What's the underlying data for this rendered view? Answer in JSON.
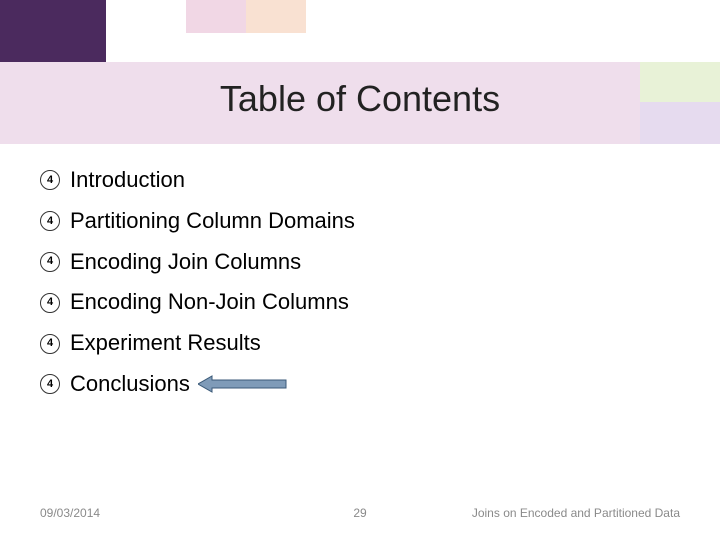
{
  "title": "Table of Contents",
  "bullet_number": "4",
  "items": [
    {
      "label": "Introduction",
      "highlighted": false
    },
    {
      "label": "Partitioning Column Domains",
      "highlighted": false
    },
    {
      "label": "Encoding Join Columns",
      "highlighted": false
    },
    {
      "label": "Encoding Non-Join Columns",
      "highlighted": false
    },
    {
      "label": "Experiment Results",
      "highlighted": false
    },
    {
      "label": "Conclusions",
      "highlighted": true
    }
  ],
  "footer": {
    "date": "09/03/2014",
    "page": "29",
    "title": "Joins on Encoded and Partitioned Data"
  },
  "colors": {
    "arrow_fill": "#7f9bb8",
    "arrow_stroke": "#3b5a78"
  }
}
